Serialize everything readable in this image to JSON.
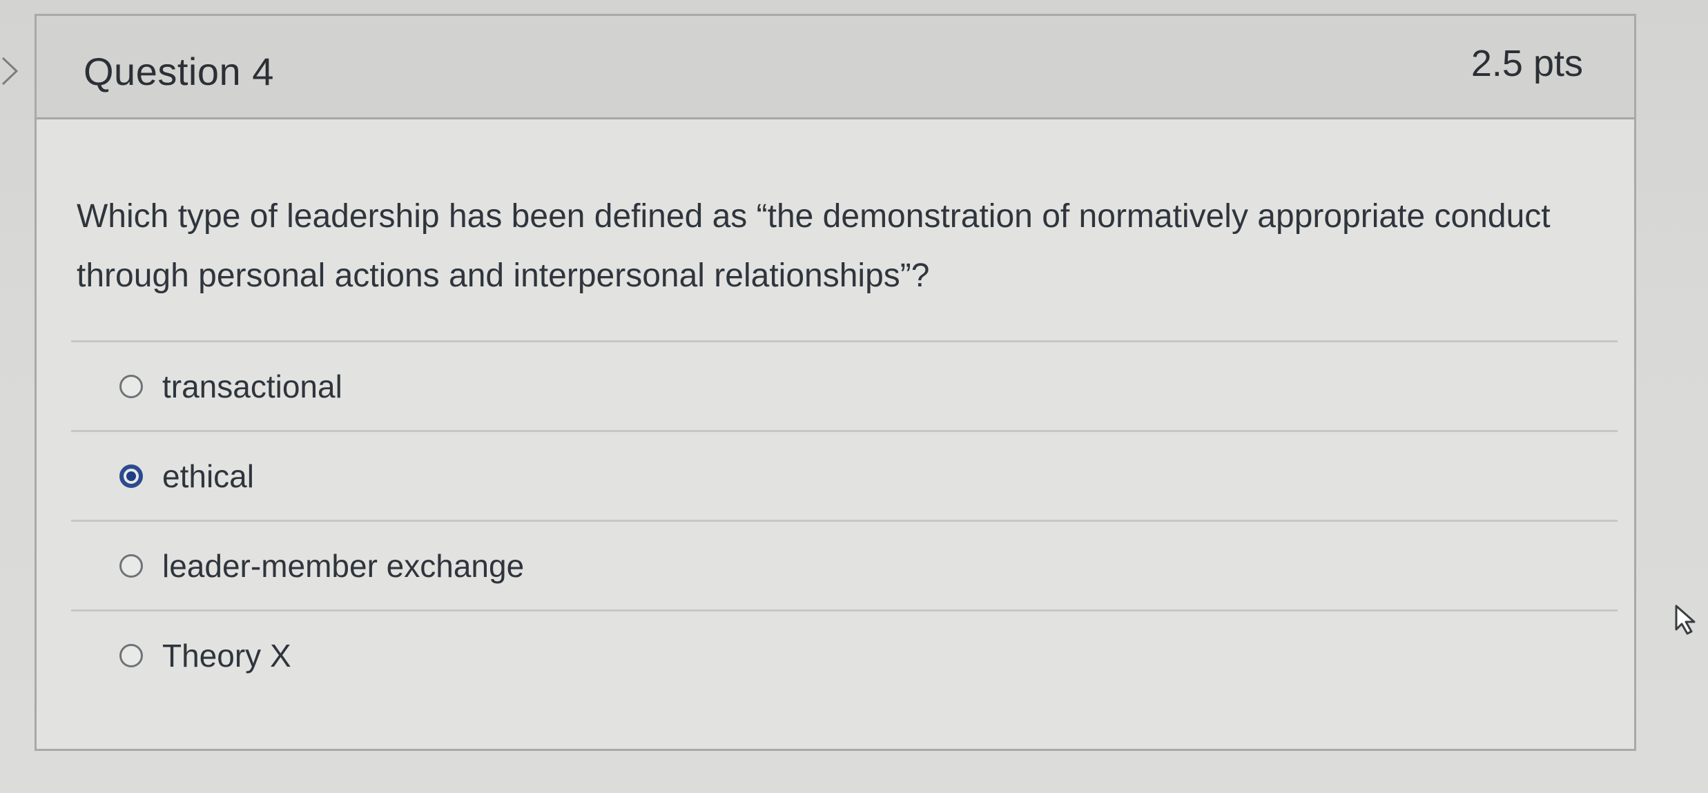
{
  "question": {
    "title": "Question 4",
    "points": "2.5 pts",
    "text": "Which type of leadership has been defined as “the demonstration of normatively appropriate conduct through personal actions and interpersonal relationships”?",
    "answers": [
      {
        "label": "transactional",
        "selected": false
      },
      {
        "label": "ethical",
        "selected": true
      },
      {
        "label": "leader-member exchange",
        "selected": false
      },
      {
        "label": "Theory X",
        "selected": false
      }
    ]
  },
  "colors": {
    "accent": "#2c4a8f",
    "header_bg": "#d2d2d0",
    "card_bg": "#e2e2e0"
  },
  "icons": {
    "nav": "chevron-right-icon",
    "cursor": "mouse-pointer-icon"
  }
}
